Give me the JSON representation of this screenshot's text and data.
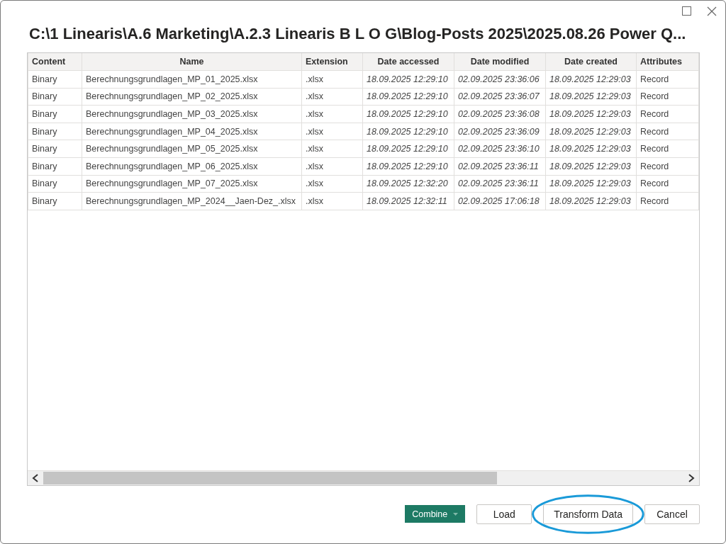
{
  "window": {
    "title": "C:\\1 Linearis\\A.6 Marketing\\A.2.3 Linearis B L O G\\Blog-Posts 2025\\2025.08.26 Power Q..."
  },
  "table": {
    "columns": [
      {
        "label": "Content",
        "kind": "text"
      },
      {
        "label": "Name",
        "kind": "text"
      },
      {
        "label": "Extension",
        "kind": "text"
      },
      {
        "label": "Date accessed",
        "kind": "datetime"
      },
      {
        "label": "Date modified",
        "kind": "datetime"
      },
      {
        "label": "Date created",
        "kind": "datetime"
      },
      {
        "label": "Attributes",
        "kind": "text"
      }
    ],
    "rows": [
      [
        "Binary",
        "Berechnungsgrundlagen_MP_01_2025.xlsx",
        ".xlsx",
        "18.09.2025 12:29:10",
        "02.09.2025 23:36:06",
        "18.09.2025 12:29:03",
        "Record"
      ],
      [
        "Binary",
        "Berechnungsgrundlagen_MP_02_2025.xlsx",
        ".xlsx",
        "18.09.2025 12:29:10",
        "02.09.2025 23:36:07",
        "18.09.2025 12:29:03",
        "Record"
      ],
      [
        "Binary",
        "Berechnungsgrundlagen_MP_03_2025.xlsx",
        ".xlsx",
        "18.09.2025 12:29:10",
        "02.09.2025 23:36:08",
        "18.09.2025 12:29:03",
        "Record"
      ],
      [
        "Binary",
        "Berechnungsgrundlagen_MP_04_2025.xlsx",
        ".xlsx",
        "18.09.2025 12:29:10",
        "02.09.2025 23:36:09",
        "18.09.2025 12:29:03",
        "Record"
      ],
      [
        "Binary",
        "Berechnungsgrundlagen_MP_05_2025.xlsx",
        ".xlsx",
        "18.09.2025 12:29:10",
        "02.09.2025 23:36:10",
        "18.09.2025 12:29:03",
        "Record"
      ],
      [
        "Binary",
        "Berechnungsgrundlagen_MP_06_2025.xlsx",
        ".xlsx",
        "18.09.2025 12:29:10",
        "02.09.2025 23:36:11",
        "18.09.2025 12:29:03",
        "Record"
      ],
      [
        "Binary",
        "Berechnungsgrundlagen_MP_07_2025.xlsx",
        ".xlsx",
        "18.09.2025 12:32:20",
        "02.09.2025 23:36:11",
        "18.09.2025 12:29:03",
        "Record"
      ],
      [
        "Binary",
        "Berechnungsgrundlagen_MP_2024__Jaen-Dez_.xlsx",
        ".xlsx",
        "18.09.2025 12:32:11",
        "02.09.2025 17:06:18",
        "18.09.2025 12:29:03",
        "Record"
      ]
    ]
  },
  "buttons": [
    {
      "label": "Combine",
      "kind": "split",
      "highlighted": false
    },
    {
      "label": "Load",
      "kind": "plain",
      "highlighted": false
    },
    {
      "label": "Transform Data",
      "kind": "plain",
      "highlighted": true
    },
    {
      "label": "Cancel",
      "kind": "plain",
      "highlighted": false
    }
  ]
}
